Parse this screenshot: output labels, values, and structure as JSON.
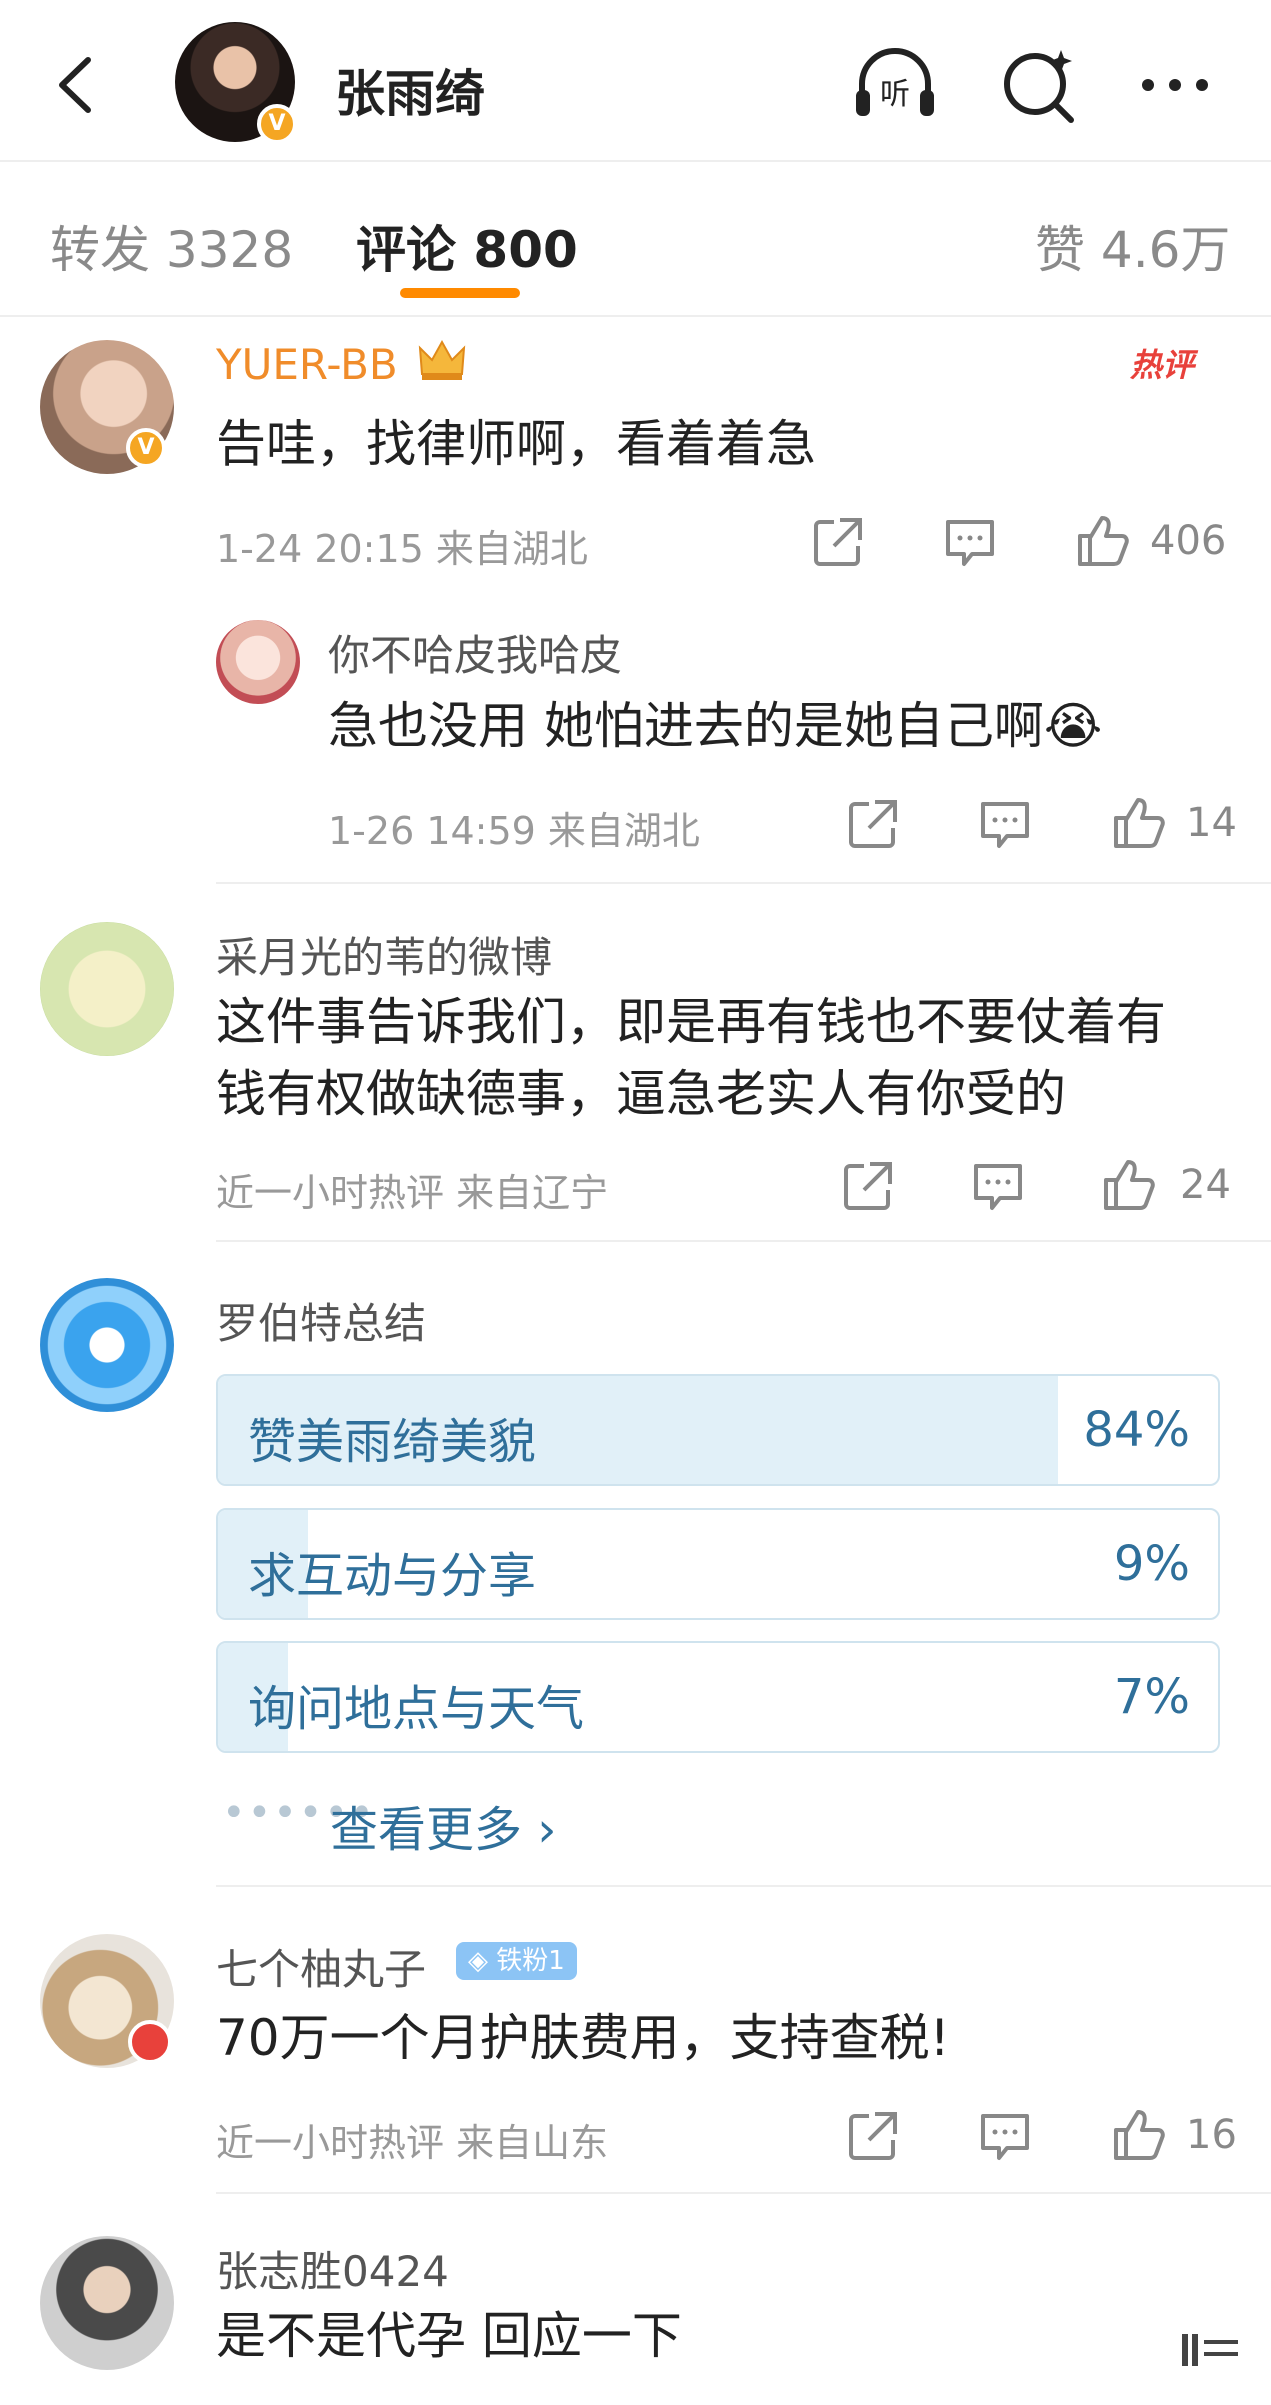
{
  "header": {
    "title": "张雨绮",
    "verified_badge": "V",
    "icons": [
      "back-icon",
      "listen-icon",
      "search-icon",
      "more-icon"
    ],
    "listen_label": "听"
  },
  "tabs": {
    "repost": "转发 3328",
    "comments": "评论 800",
    "likes": "赞 4.6万"
  },
  "comments": [
    {
      "user": "YUER-BB",
      "hot_tag": "热评",
      "text": "告哇，找律师啊，看着着急",
      "meta": "1-24 20:15  来自湖北",
      "likes": "406",
      "reply": {
        "user": "你不哈皮我哈皮",
        "text": "急也没用 她怕进去的是她自己啊😭",
        "meta": "1-26 14:59  来自湖北",
        "likes": "14"
      }
    },
    {
      "user": "采月光的苇的微博",
      "text_line1": "这件事告诉我们，即是再有钱也不要仗着有",
      "text_line2": "钱有权做缺德事，逼急老实人有你受的",
      "meta": "近一小时热评  来自辽宁",
      "likes": "24"
    },
    {
      "user": "七个柚丸子",
      "fan_badge": "◈ 铁粉1",
      "text": "70万一个月护肤费用，支持查税!",
      "meta": "近一小时热评  来自山东",
      "likes": "16"
    },
    {
      "user": "张志胜0424",
      "text": "是不是代孕 回应一下"
    }
  ],
  "poll": {
    "title": "罗伯特总结",
    "options": [
      {
        "label": "赞美雨绮美貌",
        "pct": "84%",
        "fraction": 0.84
      },
      {
        "label": "求互动与分享",
        "pct": "9%",
        "fraction": 0.09
      },
      {
        "label": "询问地点与天气",
        "pct": "7%",
        "fraction": 0.07
      }
    ],
    "see_more": "查看更多 ›"
  },
  "colors": {
    "accent": "#ff8a00",
    "username_vip": "#f08c2a",
    "poll_text": "#2f6f9a",
    "poll_fill": "#e1f0f8",
    "hot": "#e8413b"
  }
}
